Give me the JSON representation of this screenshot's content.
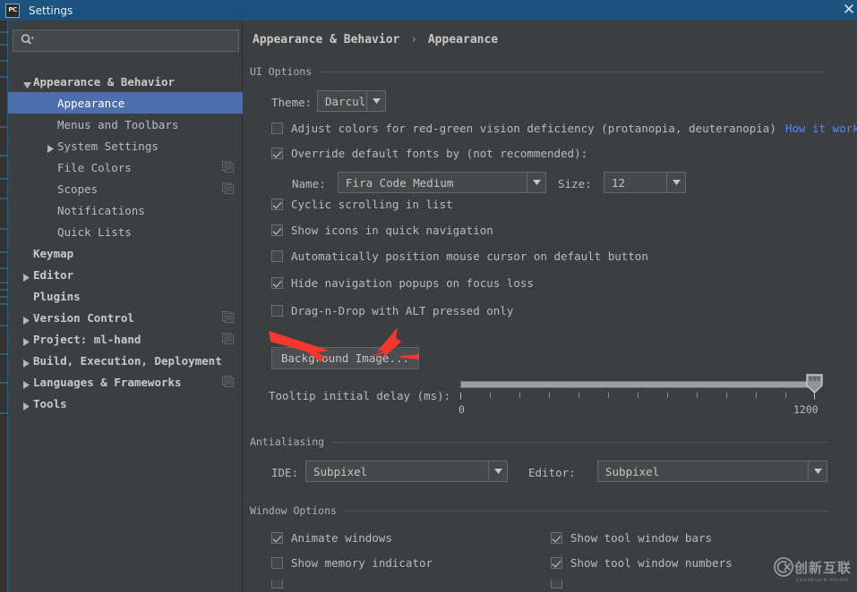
{
  "window": {
    "title": "Settings",
    "app_icon": "pycharm-icon",
    "close_label": "✕"
  },
  "sidebar": {
    "search": {
      "placeholder": "",
      "value": "",
      "icon": "search-icon"
    },
    "items": [
      {
        "label": "Appearance & Behavior",
        "indent": 0,
        "twisty": "down",
        "bold": true,
        "selected": false,
        "copy": false
      },
      {
        "label": "Appearance",
        "indent": 1,
        "twisty": "none",
        "bold": false,
        "selected": true,
        "copy": false
      },
      {
        "label": "Menus and Toolbars",
        "indent": 1,
        "twisty": "none",
        "bold": false,
        "selected": false,
        "copy": false
      },
      {
        "label": "System Settings",
        "indent": 1,
        "twisty": "right",
        "bold": false,
        "selected": false,
        "copy": false
      },
      {
        "label": "File Colors",
        "indent": 1,
        "twisty": "none",
        "bold": false,
        "selected": false,
        "copy": true
      },
      {
        "label": "Scopes",
        "indent": 1,
        "twisty": "none",
        "bold": false,
        "selected": false,
        "copy": true
      },
      {
        "label": "Notifications",
        "indent": 1,
        "twisty": "none",
        "bold": false,
        "selected": false,
        "copy": false
      },
      {
        "label": "Quick Lists",
        "indent": 1,
        "twisty": "none",
        "bold": false,
        "selected": false,
        "copy": false
      },
      {
        "label": "Keymap",
        "indent": 0,
        "twisty": "none",
        "bold": true,
        "selected": false,
        "copy": false
      },
      {
        "label": "Editor",
        "indent": 0,
        "twisty": "right",
        "bold": true,
        "selected": false,
        "copy": false
      },
      {
        "label": "Plugins",
        "indent": 0,
        "twisty": "none",
        "bold": true,
        "selected": false,
        "copy": false
      },
      {
        "label": "Version Control",
        "indent": 0,
        "twisty": "right",
        "bold": true,
        "selected": false,
        "copy": true
      },
      {
        "label": "Project: ml-hand",
        "indent": 0,
        "twisty": "right",
        "bold": true,
        "selected": false,
        "copy": true
      },
      {
        "label": "Build, Execution, Deployment",
        "indent": 0,
        "twisty": "right",
        "bold": true,
        "selected": false,
        "copy": false
      },
      {
        "label": "Languages & Frameworks",
        "indent": 0,
        "twisty": "right",
        "bold": true,
        "selected": false,
        "copy": true
      },
      {
        "label": "Tools",
        "indent": 0,
        "twisty": "right",
        "bold": true,
        "selected": false,
        "copy": false
      }
    ]
  },
  "breadcrumb": {
    "parent": "Appearance & Behavior",
    "separator": "›",
    "current": "Appearance"
  },
  "ui_options": {
    "group_title": "UI Options",
    "theme_label": "Theme:",
    "theme_value": "Darcula",
    "adjust_colors_label": "Adjust colors for red-green vision deficiency (protanopia, deuteranopia)",
    "adjust_colors_checked": false,
    "how_it_works_link": "How it works",
    "override_fonts_label": "Override default fonts by (not recommended):",
    "override_fonts_checked": true,
    "name_label": "Name:",
    "name_value": "Fira Code Medium",
    "size_label": "Size:",
    "size_value": "12",
    "checkboxes": [
      {
        "label": "Cyclic scrolling in list",
        "checked": true
      },
      {
        "label": "Show icons in quick navigation",
        "checked": true
      },
      {
        "label": "Automatically position mouse cursor on default button",
        "checked": false
      },
      {
        "label": "Hide navigation popups on focus loss",
        "checked": true
      },
      {
        "label": "Drag-n-Drop with ALT pressed only",
        "checked": false
      }
    ],
    "background_image_button": "Background Image...",
    "tooltip_delay_label": "Tooltip initial delay (ms):",
    "tooltip_delay_min": "0",
    "tooltip_delay_max": "1200",
    "tooltip_delay_value": "999"
  },
  "antialiasing": {
    "group_title": "Antialiasing",
    "ide_label": "IDE:",
    "ide_value": "Subpixel",
    "editor_label": "Editor:",
    "editor_value": "Subpixel"
  },
  "window_options": {
    "group_title": "Window Options",
    "left_column": [
      {
        "label": "Animate windows",
        "checked": true
      },
      {
        "label": "Show memory indicator",
        "checked": false
      }
    ],
    "right_column": [
      {
        "label": "Show tool window bars",
        "checked": true
      },
      {
        "label": "Show tool window numbers",
        "checked": true
      }
    ]
  },
  "watermark": {
    "cn": "创新互联",
    "en": "CHUANGXIN HULIAN",
    "mark": "CX"
  },
  "colors": {
    "titlebar": "#1f5582",
    "selection": "#4b6eaf",
    "panel_bg": "#3c3f41",
    "link": "#548af7",
    "annotation_red": "#f2382f",
    "text": "#bbbbbb"
  }
}
